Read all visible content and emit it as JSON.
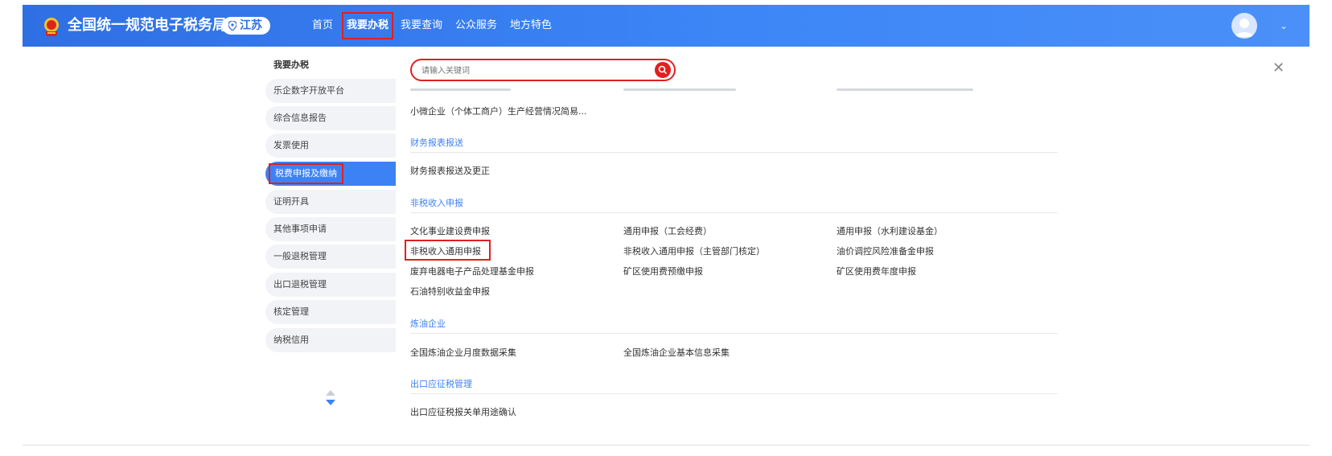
{
  "header": {
    "site_title": "全国统一规范电子税务局",
    "region": "江苏",
    "nav": [
      "首页",
      "我要办税",
      "我要查询",
      "公众服务",
      "地方特色"
    ],
    "active_nav": "我要办税"
  },
  "sidebar": {
    "heading": "我要办税",
    "items": [
      "乐企数字开放平台",
      "综合信息报告",
      "发票使用",
      "税费申报及缴纳",
      "证明开具",
      "其他事项申请",
      "一般退税管理",
      "出口退税管理",
      "核定管理",
      "纳税信用"
    ],
    "active_index": 3
  },
  "search": {
    "placeholder": "请输入关键词"
  },
  "content": {
    "top_link": "小微企业（个体工商户）生产经营情况简易...",
    "sections": [
      {
        "title": "财务报表报送",
        "links": [
          "财务报表报送及更正"
        ]
      },
      {
        "title": "非税收入申报",
        "links": [
          "文化事业建设费申报",
          "通用申报（工会经费）",
          "通用申报（水利建设基金）",
          "非税收入通用申报",
          "非税收入通用申报（主管部门核定）",
          "油价调控风险准备金申报",
          "废弃电器电子产品处理基金申报",
          "矿区使用费预缴申报",
          "矿区使用费年度申报",
          "石油特别收益金申报"
        ]
      },
      {
        "title": "炼油企业",
        "links": [
          "全国炼油企业月度数据采集",
          "全国炼油企业基本信息采集"
        ]
      },
      {
        "title": "出口应征税管理",
        "links": [
          "出口应征税报关单用途确认"
        ]
      }
    ]
  },
  "colors": {
    "header_blue": "#3c86f7",
    "accent_red": "#e02020",
    "link_blue": "#3d82f5"
  }
}
